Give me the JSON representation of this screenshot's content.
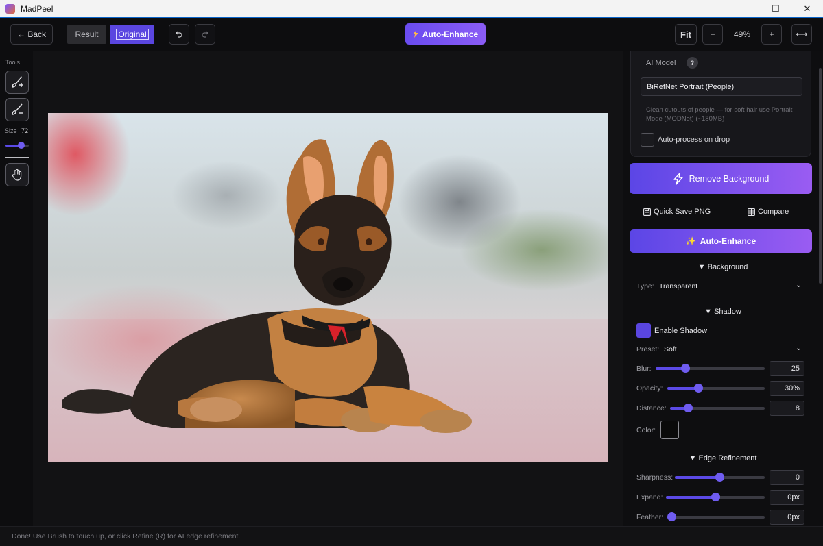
{
  "window": {
    "title": "MadPeel",
    "minimize_glyph": "—",
    "maximize_glyph": "☐",
    "close_glyph": "✕"
  },
  "toolbar": {
    "back_label": "← Back",
    "result_label": "Result",
    "original_label": "Original",
    "undo_icon": "undo-icon",
    "redo_icon": "redo-icon",
    "auto_enhance_label": "Auto-Enhance",
    "fit_label": "Fit",
    "zoom_out_label": "−",
    "zoom_level": "49%",
    "zoom_in_label": "+",
    "fit_width_label": "⟷"
  },
  "tools": {
    "label": "Tools",
    "items": [
      "brush-add-icon",
      "brush-erase-icon",
      "hand-icon"
    ],
    "size_label": "Size",
    "size_value": "72",
    "size_fraction": 0.72
  },
  "panel": {
    "ai_model_label": "AI Model",
    "help_label": "?",
    "model_selected": "BiRefNet Portrait (People)",
    "model_description": "Clean cutouts of people — for soft hair use Portrait Mode (MODNet) (~180MB)",
    "auto_process_label": "Auto-process on drop",
    "auto_process_checked": false,
    "remove_bg_label": "Remove Background",
    "quick_save_label": "Quick Save PNG",
    "compare_label": "Compare",
    "auto_enhance_label": "Auto-Enhance",
    "background": {
      "header": "▼ Background",
      "type_label": "Type:",
      "type_value": "Transparent"
    },
    "shadow": {
      "header": "▼ Shadow",
      "enable_label": "Enable Shadow",
      "enabled": true,
      "preset_label": "Preset:",
      "preset_value": "Soft",
      "blur_label": "Blur:",
      "blur_value": "25",
      "opacity_label": "Opacity:",
      "opacity_value": "30%",
      "distance_label": "Distance:",
      "distance_value": "8",
      "color_label": "Color:",
      "color_hex": "#0a0a0a"
    },
    "edge": {
      "header": "▼ Edge Refinement",
      "sharpness_label": "Sharpness:",
      "sharpness_value": "0",
      "expand_label": "Expand:",
      "expand_value": "0px",
      "feather_label": "Feather:",
      "feather_value": "0px"
    }
  },
  "status": {
    "message": "Done! Use Brush to touch up, or click Refine (R) for AI edge refinement."
  },
  "colors": {
    "accent": "#5b46e6",
    "accent2": "#9a5cf2",
    "bg": "#0b0b0c",
    "panel": "#0e0e10"
  }
}
